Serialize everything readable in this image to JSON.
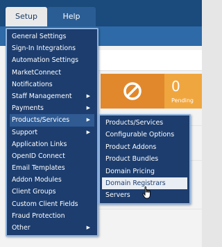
{
  "nav": {
    "tabs": [
      {
        "label": "Setup",
        "active": true
      },
      {
        "label": "Help",
        "active": false
      }
    ]
  },
  "setup_menu": {
    "items": [
      {
        "label": "General Settings",
        "has_submenu": false
      },
      {
        "label": "Sign-In Integrations",
        "has_submenu": false
      },
      {
        "label": "Automation Settings",
        "has_submenu": false
      },
      {
        "label": "MarketConnect",
        "has_submenu": false
      },
      {
        "label": "Notifications",
        "has_submenu": false
      },
      {
        "label": "Staff Management",
        "has_submenu": true
      },
      {
        "label": "Payments",
        "has_submenu": true
      },
      {
        "label": "Products/Services",
        "has_submenu": true,
        "active": true
      },
      {
        "label": "Support",
        "has_submenu": true
      },
      {
        "label": "Application Links",
        "has_submenu": false
      },
      {
        "label": "OpenID Connect",
        "has_submenu": false
      },
      {
        "label": "Email Templates",
        "has_submenu": false
      },
      {
        "label": "Addon Modules",
        "has_submenu": false
      },
      {
        "label": "Client Groups",
        "has_submenu": false
      },
      {
        "label": "Custom Client Fields",
        "has_submenu": false
      },
      {
        "label": "Fraud Protection",
        "has_submenu": false
      },
      {
        "label": "Other",
        "has_submenu": true
      }
    ],
    "submenu_arrow": "▶"
  },
  "products_submenu": {
    "items": [
      {
        "label": "Products/Services"
      },
      {
        "label": "Configurable Options"
      },
      {
        "label": "Product Addons"
      },
      {
        "label": "Product Bundles"
      },
      {
        "label": "Domain Pricing"
      },
      {
        "label": "Domain Registrars",
        "hovered": true
      },
      {
        "label": "Servers"
      }
    ]
  },
  "stats_widget": {
    "icon": "no-entry-icon",
    "value": "0",
    "label": "Pending"
  },
  "colors": {
    "topbar": "#1b4a7c",
    "menu_bg": "#1c3d6e",
    "menu_border": "#8fb4e0",
    "stat_dark": "#e2882c",
    "stat_light": "#f0a63f",
    "hover_bg": "#e9eef5"
  }
}
